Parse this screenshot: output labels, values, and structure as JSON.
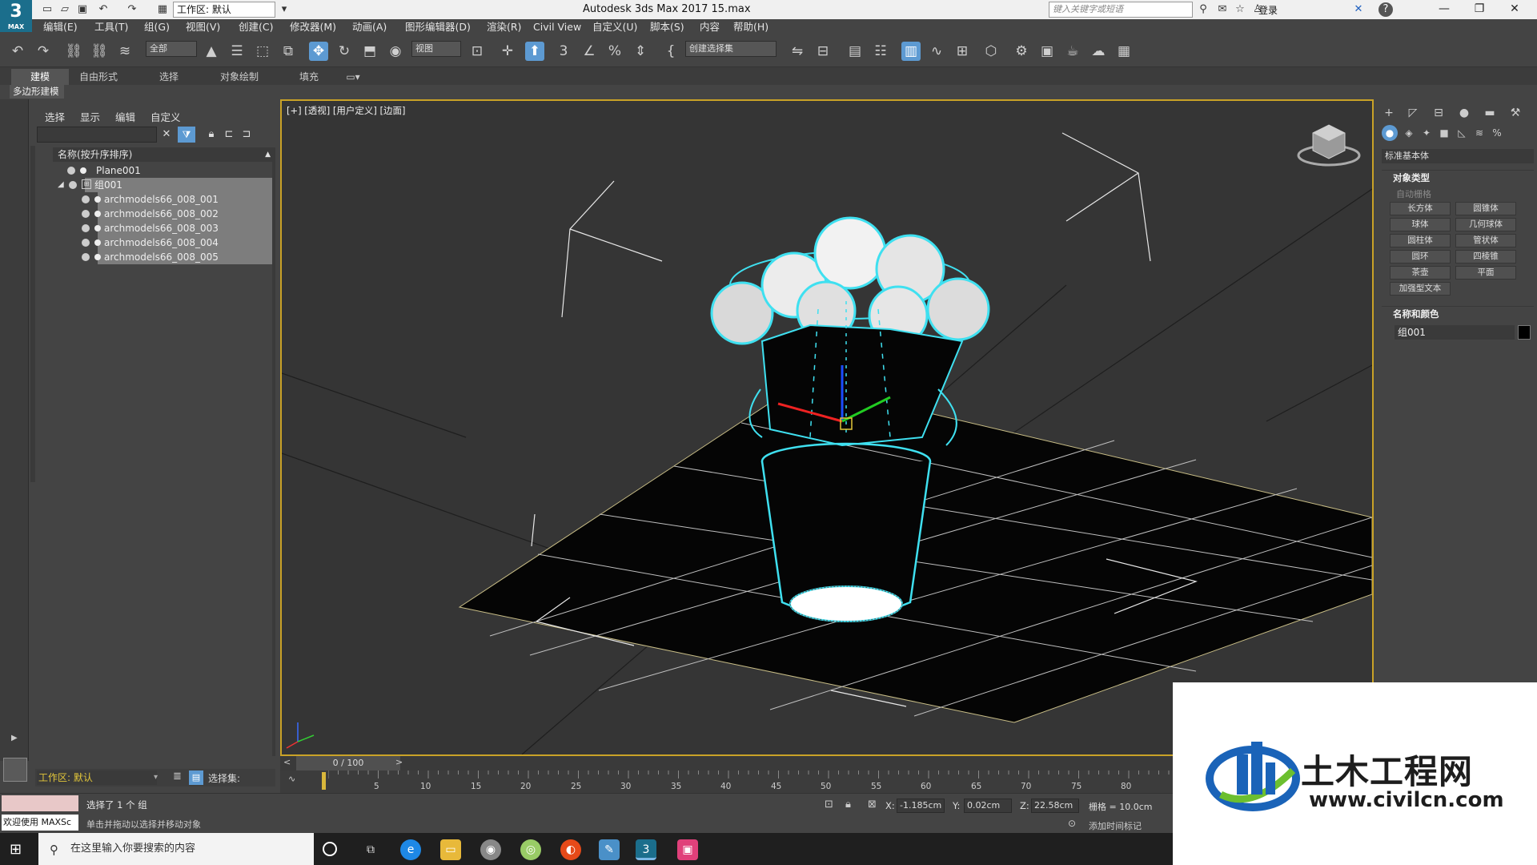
{
  "titlebar": {
    "logo_text": "3",
    "logo_sub": "MAX",
    "workspace": "工作区: 默认",
    "app_title": "Autodesk 3ds Max 2017      15.max",
    "search_placeholder": "键入关键字或短语",
    "login": "登录"
  },
  "menu": [
    "编辑(E)",
    "工具(T)",
    "组(G)",
    "视图(V)",
    "创建(C)",
    "修改器(M)",
    "动画(A)",
    "图形编辑器(D)",
    "渲染(R)",
    "Civil View",
    "自定义(U)",
    "脚本(S)",
    "内容",
    "帮助(H)"
  ],
  "toolbar": {
    "selection_filter": "全部",
    "ref_coord": "视图",
    "named_selection": "创建选择集"
  },
  "ribbon": {
    "tabs": [
      "建模",
      "自由形式",
      "选择",
      "对象绘制",
      "填充"
    ],
    "sub_label": "多边形建模"
  },
  "explorer": {
    "tabs": [
      "选择",
      "显示",
      "编辑",
      "自定义"
    ],
    "header": "名称(按升序排序)",
    "rows": [
      {
        "name": "Plane001",
        "indent": 0,
        "selected": false
      },
      {
        "name": "组001",
        "indent": 0,
        "selected": true
      },
      {
        "name": "archmodels66_008_001",
        "indent": 1,
        "selected": true
      },
      {
        "name": "archmodels66_008_002",
        "indent": 1,
        "selected": true
      },
      {
        "name": "archmodels66_008_003",
        "indent": 1,
        "selected": true
      },
      {
        "name": "archmodels66_008_004",
        "indent": 1,
        "selected": true
      },
      {
        "name": "archmodels66_008_005",
        "indent": 1,
        "selected": true
      }
    ]
  },
  "viewport": {
    "label": "[+] [透视] [用户定义] [边面]"
  },
  "command_panel": {
    "category": "标准基本体",
    "object_type_title": "对象类型",
    "autogrid": "自动栅格",
    "buttons": [
      "长方体",
      "圆锥体",
      "球体",
      "几何球体",
      "圆柱体",
      "管状体",
      "圆环",
      "四棱锥",
      "茶壶",
      "平面",
      "加强型文本"
    ],
    "name_color_title": "名称和颜色",
    "object_name": "组001"
  },
  "time": {
    "frame": "0 / 100",
    "ticks": [
      "5",
      "10",
      "15",
      "20",
      "25",
      "30",
      "35",
      "40",
      "45",
      "50",
      "55",
      "60",
      "65",
      "70",
      "75",
      "80"
    ]
  },
  "workspace_strip": {
    "workspace": "工作区: 默认",
    "selection_set_label": "选择集:"
  },
  "status": {
    "maxscript": "欢迎使用 MAXSc",
    "line1": "选择了 1 个 组",
    "line2": "单击并拖动以选择并移动对象",
    "x_label": "X:",
    "x_value": "-1.185cm",
    "y_label": "Y:",
    "y_value": "0.02cm",
    "z_label": "Z:",
    "z_value": "22.58cm",
    "grid": "栅格 = 10.0cm",
    "add_time_tag": "添加时间标记"
  },
  "taskbar": {
    "search_placeholder": "在这里输入你要搜索的内容"
  },
  "watermark": {
    "title": "土木工程网",
    "url": "www.civilcn.com"
  },
  "colors": {
    "accent_selection": "#5d9ad2",
    "viewport_border": "#c9a227",
    "wire_cyan": "#3fe0f0"
  }
}
